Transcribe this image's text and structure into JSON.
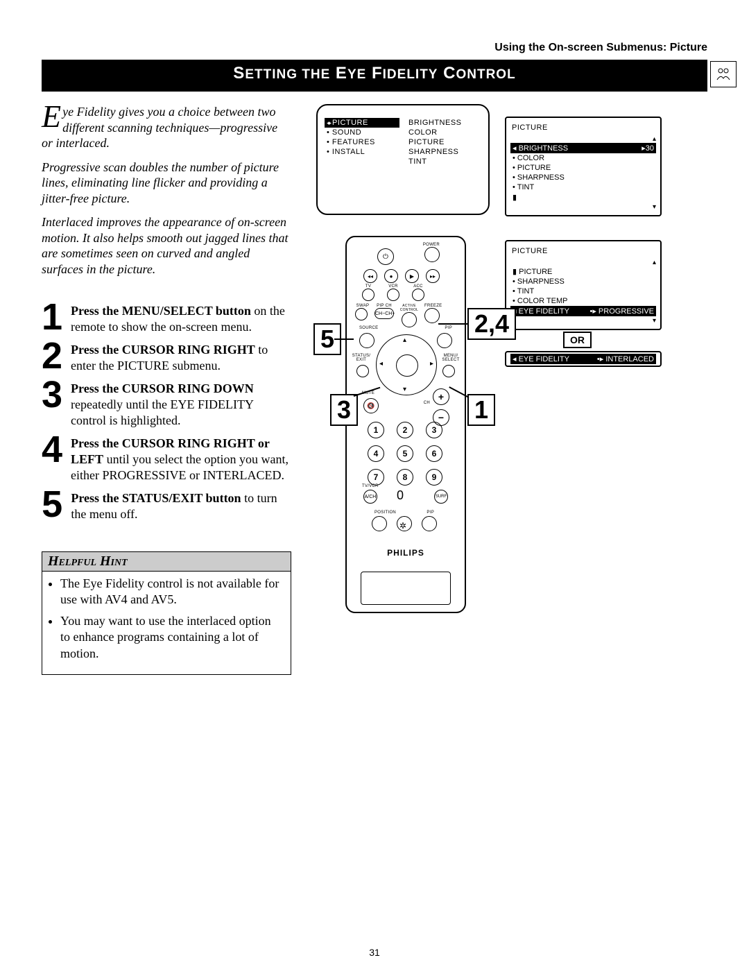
{
  "breadcrumb": "Using the On-screen Submenus: Picture",
  "title": "Setting the Eye Fidelity Control",
  "intro": {
    "dropcap": "E",
    "p1_rest": "ye Fidelity gives you a choice between two different scanning techniques—progressive or interlaced.",
    "p2": "Progressive scan doubles the number of picture lines, eliminating line flicker and providing a jitter-free picture.",
    "p3": "Interlaced improves the appearance of on-screen motion. It also helps smooth out jagged lines that are sometimes seen on curved and angled surfaces in the picture."
  },
  "steps": [
    {
      "num": "1",
      "bold": "Press the MENU/SELECT button",
      "rest": " on the remote to show the on-screen menu."
    },
    {
      "num": "2",
      "bold": "Press the CURSOR RING RIGHT",
      "rest": " to enter the PICTURE submenu."
    },
    {
      "num": "3",
      "bold": "Press the CURSOR RING DOWN",
      "rest": " repeatedly until the EYE FIDELITY control is highlighted."
    },
    {
      "num": "4",
      "bold": "Press the CURSOR RING RIGHT or LEFT",
      "rest": " until you select the option you want, either PROGRESSIVE or INTERLACED."
    },
    {
      "num": "5",
      "bold": "Press the STATUS/EXIT button",
      "rest": " to turn the menu off."
    }
  ],
  "hint": {
    "title": "Helpful Hint",
    "items": [
      "The Eye Fidelity control is not available for use with AV4 and AV5.",
      "You may want to use the interlaced option to enhance programs containing a lot of motion."
    ]
  },
  "osd_main": {
    "left": [
      {
        "label": "PICTURE",
        "sel": true,
        "prefix": "arr"
      },
      {
        "label": "SOUND",
        "prefix": "dot"
      },
      {
        "label": "FEATURES",
        "prefix": "dot"
      },
      {
        "label": "INSTALL",
        "prefix": "dot"
      }
    ],
    "right": [
      "BRIGHTNESS",
      "COLOR",
      "PICTURE",
      "SHARPNESS",
      "TINT"
    ]
  },
  "osd_r1": {
    "hdr": "PICTURE",
    "rows": [
      {
        "label": "BRIGHTNESS",
        "sel": true,
        "value": "30",
        "bar": true
      },
      {
        "label": "COLOR",
        "dot": true
      },
      {
        "label": "PICTURE",
        "dot": true
      },
      {
        "label": "SHARPNESS",
        "dot": true
      },
      {
        "label": "TINT",
        "dot": true
      }
    ]
  },
  "osd_r2": {
    "hdr": "PICTURE",
    "rows": [
      {
        "label": "PICTURE",
        "dot": true,
        "bar": true
      },
      {
        "label": "SHARPNESS",
        "dot": true
      },
      {
        "label": "TINT",
        "dot": true
      },
      {
        "label": "COLOR TEMP",
        "dot": true
      },
      {
        "label": "EYE FIDELITY",
        "sel": true,
        "value": "PROGRESSIVE"
      }
    ]
  },
  "or_label": "OR",
  "osd_r3": {
    "label": "EYE FIDELITY",
    "value": "INTERLACED"
  },
  "callouts": {
    "c5": "5",
    "c24": "2,4",
    "c3": "3",
    "c1": "1"
  },
  "remote": {
    "brand": "PHILIPS",
    "power": "POWER",
    "mode_tv": "TV",
    "mode_vcr": "VCR",
    "mode_acc": "ACC",
    "swap": "SWAP",
    "pipch": "PIP CH",
    "active": "ACTIVE CONTROL",
    "freeze": "FREEZE",
    "source": "SOURCE",
    "pip": "PIP",
    "status": "STATUS/\nEXIT",
    "menu": "MENU/\nSELECT",
    "mute": "MUTE",
    "ch": "CH",
    "numpad": [
      "1",
      "2",
      "3",
      "4",
      "5",
      "6",
      "7",
      "8",
      "9",
      "0"
    ],
    "tvvcr": "TV/VCR",
    "ach": "A/CH",
    "surf": "SURF",
    "position": "POSITION",
    "pip2": "PIP"
  },
  "page_number": "31"
}
